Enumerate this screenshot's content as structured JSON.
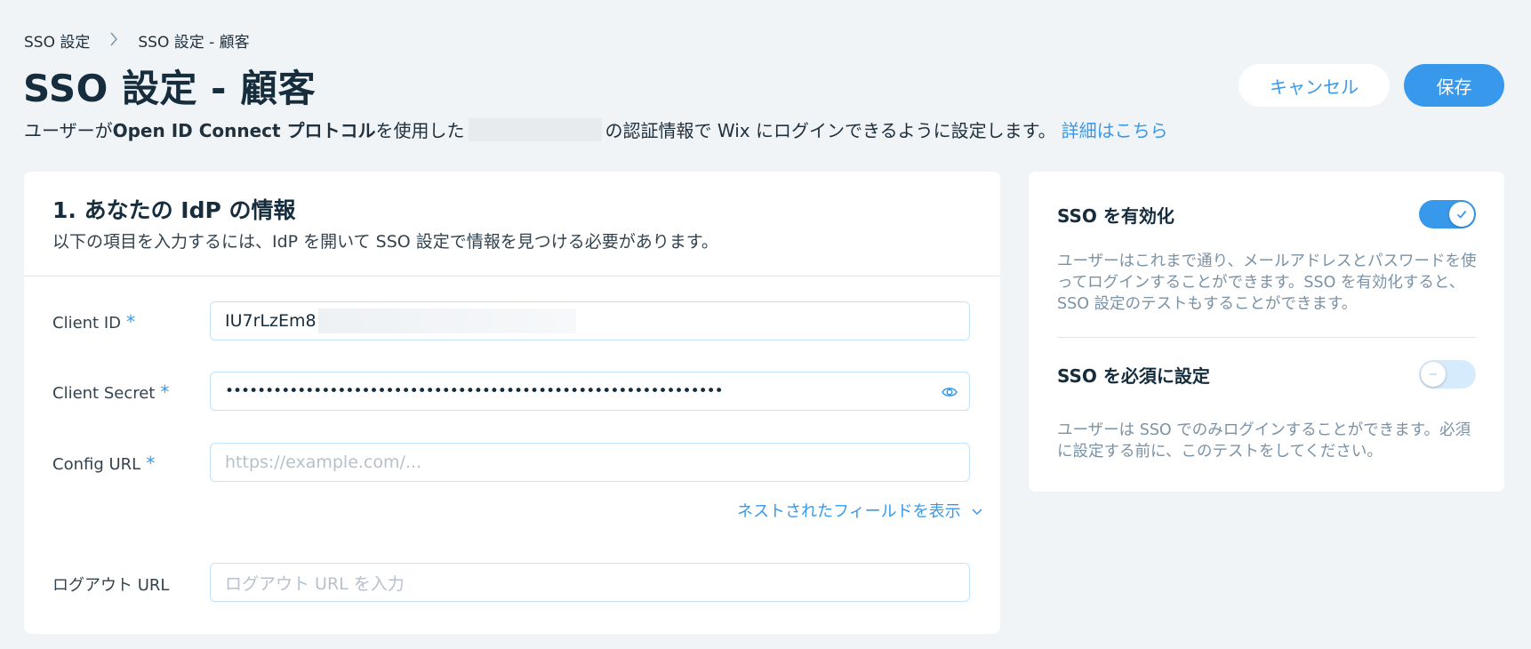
{
  "breadcrumb": {
    "root": "SSO 設定",
    "current": "SSO 設定 - 顧客"
  },
  "page": {
    "title": "SSO 設定 - 顧客",
    "subtitle_pre": "ユーザーが ",
    "subtitle_bold": "Open ID Connect プロトコル",
    "subtitle_mid": "を使用した",
    "subtitle_post": "の認証情報で Wix にログインできるように設定します。",
    "learn_more": "詳細はこちら"
  },
  "actions": {
    "cancel": "キャンセル",
    "save": "保存"
  },
  "idp": {
    "title": "1. あなたの IdP の情報",
    "description": "以下の項目を入力するには、IdP を開いて SSO 設定で情報を見つける必要があります。",
    "required_mark": "*",
    "client_id": {
      "label": "Client ID",
      "value": "IU7rLzEm8"
    },
    "client_secret": {
      "label": "Client Secret",
      "value": "••••••••••••••••••••••••••••••••••••••••••••••••••••••••••••••"
    },
    "config_url": {
      "label": "Config URL",
      "placeholder": "https://example.com/..."
    },
    "nested_link": "ネストされたフィールドを表示",
    "logout_url": {
      "label": "ログアウト URL",
      "placeholder": "ログアウト URL を入力"
    }
  },
  "sso": {
    "enable": {
      "title": "SSO を有効化",
      "state": "on",
      "description": "ユーザーはこれまで通り、メールアドレスとパスワードを使ってログインすることができます。SSO を有効化すると、SSO 設定のテストもすることができます。"
    },
    "require": {
      "title": "SSO を必須に設定",
      "state": "off",
      "description": "ユーザーは SSO でのみログインすることができます。必須に設定する前に、このテストをしてください。"
    }
  },
  "colors": {
    "accent": "#3899ec",
    "background": "#f0f4f7",
    "text": "#162d3d"
  }
}
